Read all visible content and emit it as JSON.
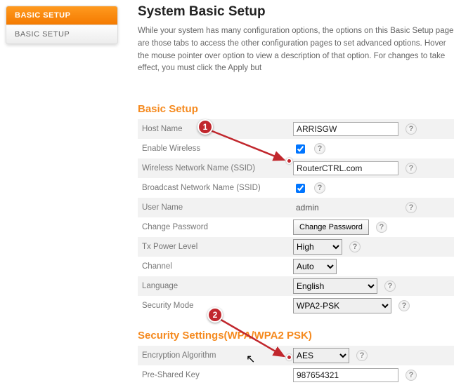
{
  "sidebar": {
    "active": "BASIC SETUP",
    "items": [
      "BASIC SETUP"
    ]
  },
  "page": {
    "title": "System Basic Setup",
    "intro": "While your system has many configuration options, the options on this Basic Setup page are those tabs to access the other configuration pages to set advanced options. Hover the mouse pointer over option to view a description of that option. For changes to take effect, you must click the Apply but"
  },
  "sections": {
    "basic": "Basic Setup",
    "security": "Security Settings(WPA/WPA2 PSK)"
  },
  "fields": {
    "host_name": {
      "label": "Host Name",
      "value": "ARRISGW"
    },
    "enable_wireless": {
      "label": "Enable Wireless",
      "checked": true
    },
    "ssid": {
      "label": "Wireless Network Name (SSID)",
      "value": "RouterCTRL.com"
    },
    "broadcast_ssid": {
      "label": "Broadcast Network Name (SSID)",
      "checked": true
    },
    "user_name": {
      "label": "User Name",
      "value": "admin"
    },
    "change_password": {
      "label": "Change Password",
      "button": "Change Password"
    },
    "tx_power": {
      "label": "Tx Power Level",
      "value": "High"
    },
    "channel": {
      "label": "Channel",
      "value": "Auto"
    },
    "language": {
      "label": "Language",
      "value": "English"
    },
    "security_mode": {
      "label": "Security Mode",
      "value": "WPA2-PSK"
    },
    "encryption": {
      "label": "Encryption Algorithm",
      "value": "AES"
    },
    "psk": {
      "label": "Pre-Shared Key",
      "value": "987654321"
    }
  },
  "annotations": {
    "marker1": "1",
    "marker2": "2"
  }
}
